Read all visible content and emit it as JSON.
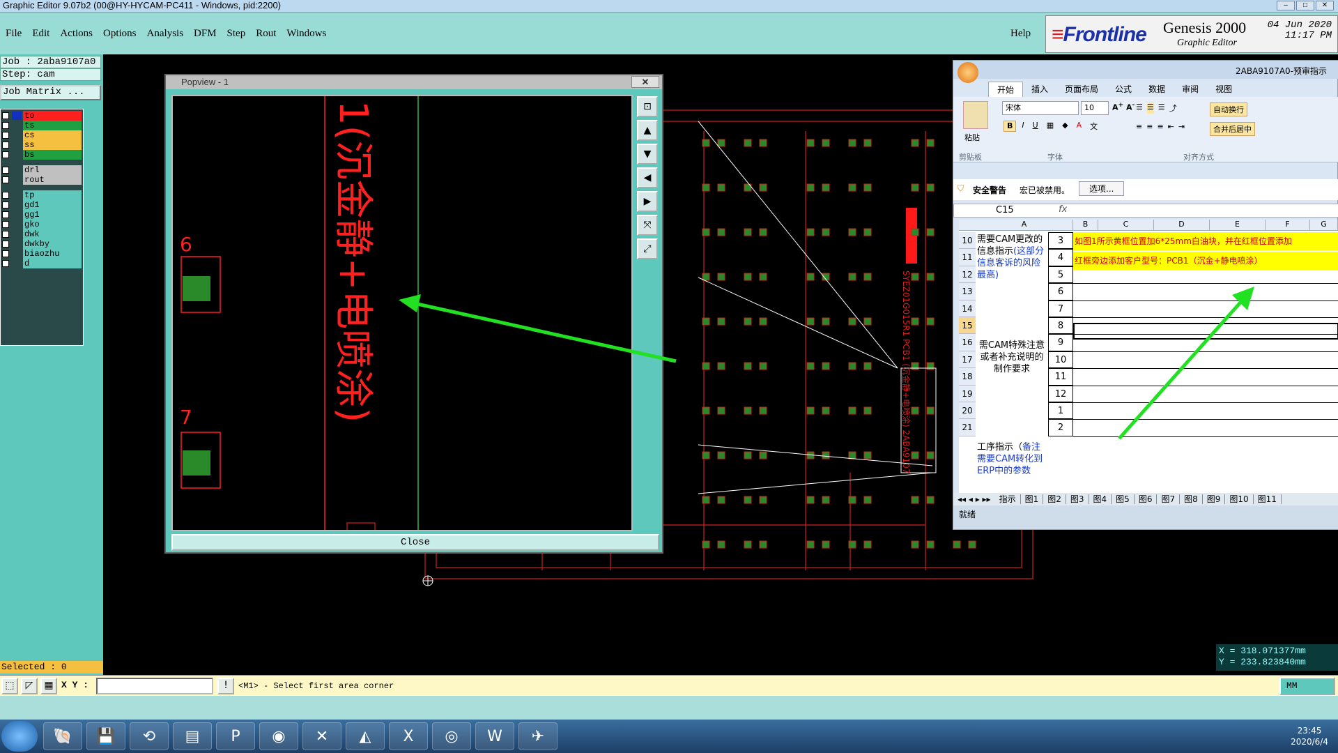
{
  "window": {
    "title": "Graphic Editor 9.07b2 (00@HY-HYCAM-PC411 - Windows, pid:2200)"
  },
  "menu": {
    "items": [
      "File",
      "Edit",
      "Actions",
      "Options",
      "Analysis",
      "DFM",
      "Step",
      "Rout",
      "Windows"
    ],
    "help": "Help"
  },
  "brand": {
    "logo": "Frontline",
    "product": "Genesis 2000",
    "subtitle": "Graphic Editor",
    "date": "04 Jun 2020",
    "time": "11:17 PM"
  },
  "left": {
    "job": "Job : 2aba9107a0",
    "step": "Step: cam",
    "job_matrix": "Job Matrix ...",
    "layers": [
      {
        "name": "to",
        "color": "#ff2020"
      },
      {
        "name": "ts",
        "color": "#20a040"
      },
      {
        "name": "cs",
        "color": "#f5c040"
      },
      {
        "name": "ss",
        "color": "#f5c040"
      },
      {
        "name": "bs",
        "color": "#20a040"
      },
      {
        "name": "drl",
        "color": "#c0c0c0"
      },
      {
        "name": "rout",
        "color": "#c0c0c0"
      },
      {
        "name": "tp",
        "color": "#5fc8bd"
      },
      {
        "name": "gd1",
        "color": "#5fc8bd"
      },
      {
        "name": "gg1",
        "color": "#5fc8bd"
      },
      {
        "name": "gko",
        "color": "#5fc8bd"
      },
      {
        "name": "dwk",
        "color": "#5fc8bd"
      },
      {
        "name": "dwkby",
        "color": "#5fc8bd"
      },
      {
        "name": "biaozhu",
        "color": "#5fc8bd"
      },
      {
        "name": "d",
        "color": "#5fc8bd"
      }
    ],
    "selected": "Selected : 0"
  },
  "popview": {
    "title": "Popview - 1",
    "close": "Close",
    "text": "1(沉金静+电喷涂)",
    "labels": [
      "6",
      "7"
    ]
  },
  "excel": {
    "title": "2ABA9107A0-预审指示",
    "tabs": [
      "开始",
      "插入",
      "页面布局",
      "公式",
      "数据",
      "审阅",
      "视图"
    ],
    "font_name": "宋体",
    "font_size": "10",
    "wrap": "自动换行",
    "merge": "合并后居中",
    "paste": "粘贴",
    "group_clipboard": "剪贴板",
    "group_font": "字体",
    "group_align": "对齐方式",
    "security_title": "安全警告",
    "security_msg": "宏已被禁用。",
    "security_btn": "选项...",
    "cell_ref": "C15",
    "fx": "fx",
    "col_headers": [
      "A",
      "B",
      "C",
      "D",
      "E",
      "F",
      "G"
    ],
    "rows": [
      {
        "num": "10",
        "b": "3"
      },
      {
        "num": "11",
        "b": "4"
      },
      {
        "num": "12",
        "b": "5"
      },
      {
        "num": "13",
        "b": "6"
      },
      {
        "num": "14",
        "b": "7"
      },
      {
        "num": "15",
        "b": "8"
      },
      {
        "num": "16",
        "b": "9"
      },
      {
        "num": "17",
        "b": "10"
      },
      {
        "num": "18",
        "b": "11"
      },
      {
        "num": "19",
        "b": "12"
      },
      {
        "num": "20",
        "b": "1"
      },
      {
        "num": "21",
        "b": "2"
      }
    ],
    "a_block1_black": "需要CAM更改的信息指示",
    "a_block1_blue": "(这部分信息客诉的风险最高)",
    "a_block2": "需CAM特殊注意或者补充说明的制作要求",
    "a_block3_black": "工序指示（",
    "a_block3_blue": "备注需要CAM转化到ERP中的参数",
    "c_row10": "如图1所示黄框位置加6*25mm白油块，并在红框位置添加",
    "c_row11": "红框旁边添加客户型号：PCB1（沉金+静电喷涂）",
    "sheet_tabs": [
      "指示",
      "图1",
      "图2",
      "图3",
      "图4",
      "图5",
      "图6",
      "图7",
      "图8",
      "图9",
      "图10",
      "图11"
    ],
    "status": "就绪"
  },
  "coords": {
    "x": "X = 318.071377mm",
    "y": "Y = 233.823840mm"
  },
  "bottom": {
    "xy_label": "X Y :",
    "prompt": "<M1> - Select first area corner",
    "units": "MM"
  },
  "taskbar": {
    "time": "23:45",
    "date": "2020/6/4"
  }
}
